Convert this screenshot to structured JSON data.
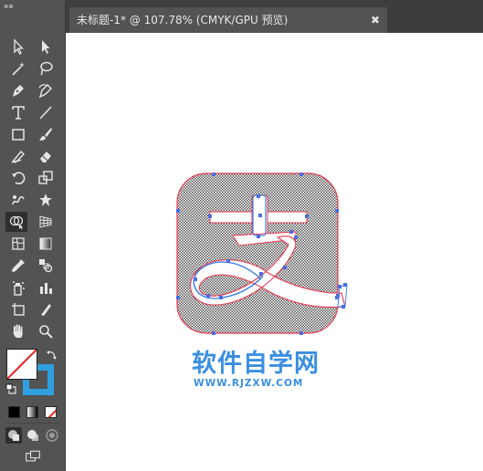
{
  "document_tab": {
    "title": "未标题-1* @ 107.78% (CMYK/GPU 预览)",
    "close_label": "✖"
  },
  "toolbar": {
    "tools": [
      "selection-tool",
      "direct-selection-tool",
      "magic-wand-tool",
      "lasso-tool",
      "pen-tool",
      "curvature-tool",
      "type-tool",
      "line-segment-tool",
      "rectangle-tool",
      "paintbrush-tool",
      "shaper-tool",
      "eraser-tool",
      "rotate-tool",
      "scale-tool",
      "warp-tool",
      "free-transform-tool",
      "shape-builder-tool",
      "perspective-grid-tool",
      "mesh-tool",
      "gradient-tool",
      "eyedropper-tool",
      "blend-tool",
      "symbol-sprayer-tool",
      "column-graph-tool",
      "artboard-tool",
      "slice-tool",
      "hand-tool",
      "zoom-tool"
    ],
    "active_tool": "shape-builder-tool",
    "fill_color": "#ffffff",
    "stroke_color": "#2f9fe0"
  },
  "watermark": {
    "name": "软件自学网",
    "url": "WWW.RJZXW.COM",
    "color": "#3b8fe0"
  },
  "artwork": {
    "path_color": "#e8384f",
    "anchor_color": "#4a6ee0",
    "selected_path_color": "#3f7ee8"
  }
}
